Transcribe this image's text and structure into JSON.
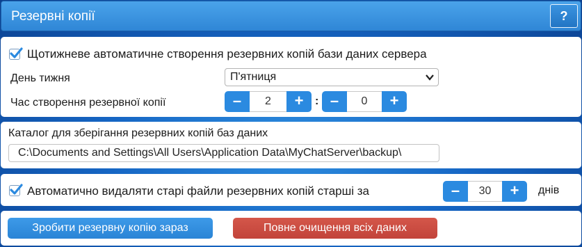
{
  "header": {
    "title": "Резервні копії",
    "help_label": "?"
  },
  "schedule": {
    "weekly_checkbox_label": "Щотижневе автоматичне створення резервних копій бази даних сервера",
    "weekly_checked": true,
    "day_label": "День тижня",
    "day_value": "П'ятниця",
    "time_label": "Час створення резервної копії",
    "hour_value": "2",
    "minute_value": "0",
    "time_separator": ":",
    "minus_label": "–",
    "plus_label": "+"
  },
  "catalog": {
    "label": "Каталог для зберігання резервних копій баз даних",
    "path_value": "C:\\Documents and Settings\\All Users\\Application Data\\MyChatServer\\backup\\"
  },
  "cleanup": {
    "checkbox_label": "Автоматично видаляти старі файли резервних копій старші за",
    "checked": true,
    "days_value": "30",
    "days_unit": "днів"
  },
  "actions": {
    "backup_now_label": "Зробити резервну копію зараз",
    "purge_label": "Повне очищення всіх даних"
  },
  "colors": {
    "accent": "#2b8ae0",
    "danger": "#c8483d",
    "header": "#3a93e0"
  }
}
